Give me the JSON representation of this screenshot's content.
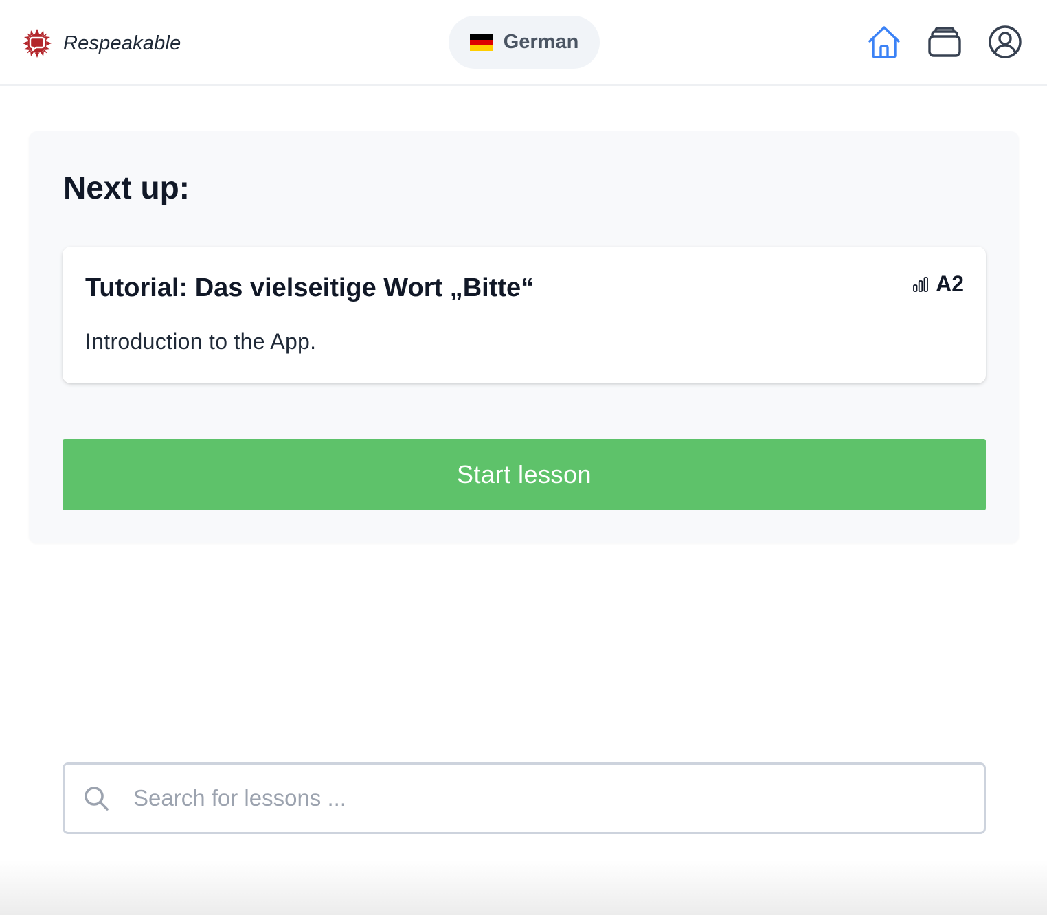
{
  "header": {
    "brand_name": "Respeakable",
    "brand_logo_icon": "speech-bubble-sun-icon",
    "language": {
      "label": "German",
      "flag_icon": "german-flag-icon",
      "flag_colors": [
        "#000000",
        "#dd0000",
        "#ffce00"
      ]
    },
    "nav": [
      {
        "name": "home",
        "icon": "home-icon",
        "active": true
      },
      {
        "name": "lessons",
        "icon": "card-stack-icon",
        "active": false
      },
      {
        "name": "profile",
        "icon": "user-circle-icon",
        "active": false
      }
    ]
  },
  "next_up": {
    "heading": "Next up:",
    "lesson": {
      "title": "Tutorial: Das vielseitige Wort „Bitte“",
      "level": "A2",
      "level_icon": "signal-bars-icon",
      "description": "Introduction to the App."
    },
    "start_button": "Start lesson"
  },
  "search": {
    "placeholder": "Search for lessons ...",
    "value": "",
    "icon": "search-icon"
  },
  "colors": {
    "accent_blue": "#3b82f6",
    "start_green": "#5ec26a",
    "brand_red": "#b3262b"
  }
}
